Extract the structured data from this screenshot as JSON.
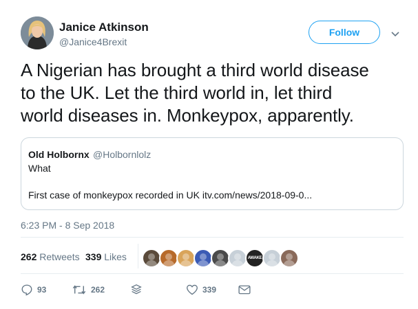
{
  "author": {
    "name": "Janice Atkinson",
    "handle": "@Janice4Brexit",
    "avatar_icon": "profile-photo"
  },
  "follow_button": {
    "label": "Follow"
  },
  "tweet": {
    "lines": [
      "A Nigerian has brought a third world disease",
      "to the UK. Let the third world in, let third",
      "world diseases in. Monkeypox, apparently."
    ]
  },
  "quoted_tweet": {
    "name": "Old Holbornx",
    "handle": "@Holbornlolz",
    "text_line1": "What",
    "text_line2": "First case of monkeypox recorded in UK itv.com/news/2018-09-0..."
  },
  "timestamp": "6:23 PM - 8 Sep 2018",
  "stats": {
    "retweets_count": "262",
    "retweets_label": "Retweets",
    "likes_count": "339",
    "likes_label": "Likes"
  },
  "liker_avatars": [
    {
      "name": "liker-avatar-1",
      "color": "#5a4a3a"
    },
    {
      "name": "liker-avatar-2",
      "color": "#b76a2a"
    },
    {
      "name": "liker-avatar-3",
      "color": "#d9a45a"
    },
    {
      "name": "liker-avatar-4",
      "color": "#3b5bb5"
    },
    {
      "name": "liker-avatar-5",
      "color": "#4a4a4a"
    },
    {
      "name": "liker-avatar-6",
      "color": "#c7d0d8"
    },
    {
      "name": "liker-avatar-7",
      "color": "#222222",
      "text": "AWAKE"
    },
    {
      "name": "liker-avatar-8",
      "color": "#c7d0d8"
    },
    {
      "name": "liker-avatar-9",
      "color": "#8a6a5a"
    }
  ],
  "actions": {
    "reply_count": "93",
    "retweet_count": "262",
    "like_count": "339"
  },
  "colors": {
    "accent": "#1da1f2",
    "secondary_text": "#657786",
    "border": "#e6ecf0"
  }
}
